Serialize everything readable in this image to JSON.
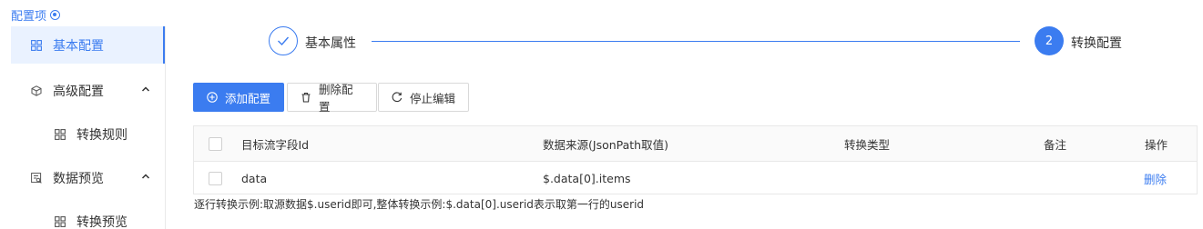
{
  "sidebar": {
    "title": "配置项",
    "items": [
      {
        "label": "基本配置"
      },
      {
        "label": "高级配置"
      },
      {
        "label": "转换规则"
      },
      {
        "label": "数据预览"
      },
      {
        "label": "转换预览"
      }
    ]
  },
  "steps": {
    "step1": {
      "label": "基本属性"
    },
    "step2": {
      "number": "2",
      "label": "转换配置"
    }
  },
  "toolbar": {
    "add_label": "添加配置",
    "delete_label": "删除配置",
    "stop_label": "停止编辑"
  },
  "table": {
    "columns": [
      "目标流字段Id",
      "数据来源(JsonPath取值)",
      "转换类型",
      "备注",
      "操作"
    ],
    "rows": [
      {
        "field_id": "data",
        "source": "$.data[0].items",
        "type": "",
        "note": "",
        "action": "删除"
      }
    ]
  },
  "hint": "逐行转换示例:取源数据$.userid即可,整体转换示例:$.data[0].userid表示取第一行的userid",
  "colors": {
    "accent": "#3b7cf0"
  }
}
